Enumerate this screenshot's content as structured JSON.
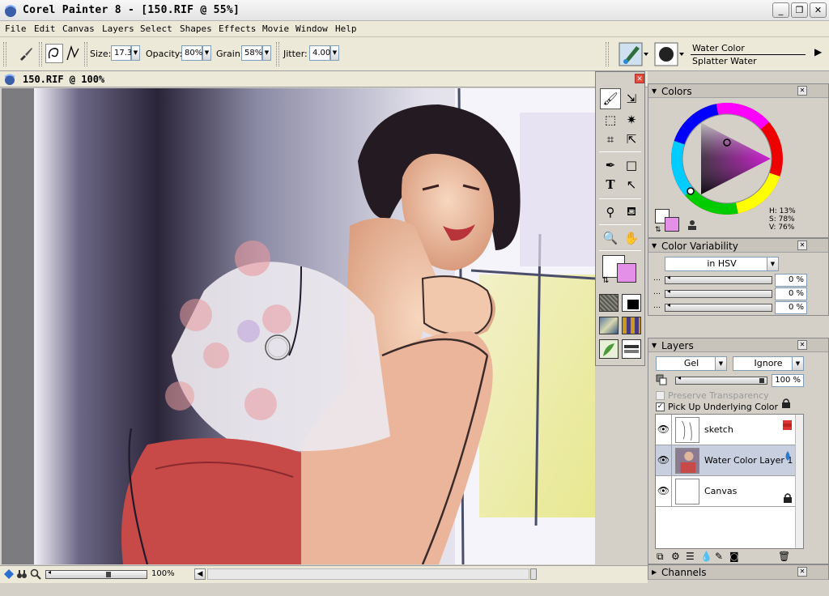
{
  "window": {
    "title": "Corel Painter 8 - [150.RIF @ 55%]",
    "minimize": "_",
    "restore": "❐",
    "close": "✕"
  },
  "menu": [
    "File",
    "Edit",
    "Canvas",
    "Layers",
    "Select",
    "Shapes",
    "Effects",
    "Movie",
    "Window",
    "Help"
  ],
  "propbar": {
    "size_label": "Size:",
    "size_value": "17.3",
    "opacity_label": "Opacity:",
    "opacity_value": "80%",
    "grain_label": "Grain:",
    "grain_value": "58%",
    "jitter_label": "Jitter:",
    "jitter_value": "4.00",
    "brush_category": "Water Color",
    "brush_variant": "Splatter Water"
  },
  "document": {
    "title": "150.RIF @ 100%",
    "zoom": "100%"
  },
  "colors_palette": {
    "title": "Colors",
    "h": "H: 13%",
    "s": "S: 78%",
    "v": "V: 76%",
    "main_color": "#ffffff",
    "additional_color": "#e48fe8"
  },
  "color_variability": {
    "title": "Color Variability",
    "mode": "in HSV",
    "values": [
      "0 %",
      "0 %",
      "0 %"
    ]
  },
  "layers_palette": {
    "title": "Layers",
    "composite_method": "Gel",
    "depth": "Ignore",
    "opacity": "100 %",
    "preserve_transparency": "Preserve Transparency",
    "pick_up_underlying": "Pick Up Underlying Color",
    "layers": [
      {
        "name": "sketch",
        "selected": false
      },
      {
        "name": "Water Color Layer 1",
        "selected": true
      },
      {
        "name": "Canvas",
        "selected": false
      }
    ]
  },
  "channels_palette": {
    "title": "Channels"
  }
}
